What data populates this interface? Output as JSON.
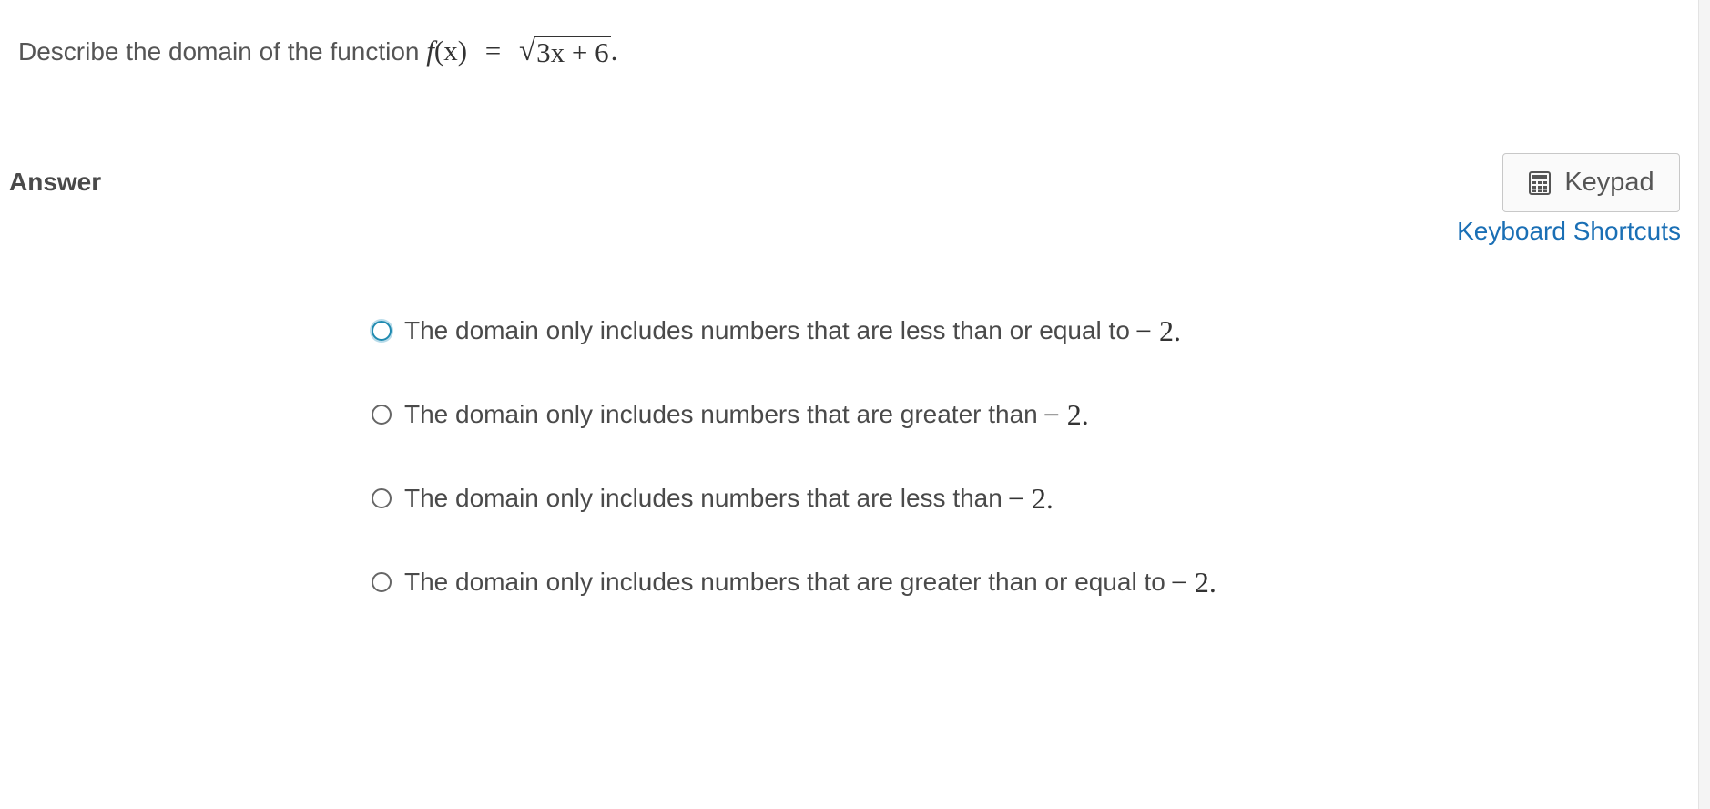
{
  "question": {
    "text": "Describe the domain of the function",
    "func_name": "f",
    "func_arg": "(x)",
    "equals": "=",
    "radicand": "3x + 6",
    "end": "."
  },
  "answer_label": "Answer",
  "keypad": {
    "label": "Keypad",
    "icon": "calculator-icon"
  },
  "keyboard_shortcuts": "Keyboard Shortcuts",
  "options": [
    {
      "text": "The domain only includes numbers that are less than or equal to",
      "math": "− 2."
    },
    {
      "text": "The domain only includes numbers that are greater than",
      "math": "− 2."
    },
    {
      "text": "The domain only includes numbers that are less than",
      "math": "− 2."
    },
    {
      "text": "The domain only includes numbers that are greater than or equal to",
      "math": "− 2."
    }
  ],
  "colors": {
    "link": "#1a6fb5",
    "focus_ring": "#1f8ab0"
  }
}
